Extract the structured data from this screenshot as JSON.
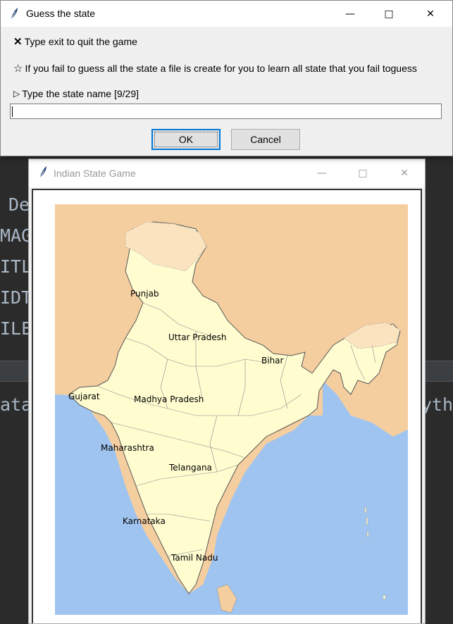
{
  "dialog": {
    "title": "Guess the state",
    "line_exit": "Type exit to quit the game",
    "line_fail": "If you fail to guess all the state a file is create for you to learn all state that you fail toguess",
    "line_prompt": "Type the state name [9/29]",
    "input_value": "",
    "ok_label": "OK",
    "cancel_label": "Cancel"
  },
  "game_window": {
    "title": "Indian State Game"
  },
  "ide_background": {
    "lines": [
      "De",
      "MAG",
      "ITL",
      "IDT",
      "ILE"
    ],
    "lower_left": "ata",
    "lower_right": "yth"
  },
  "map_labels": [
    {
      "name": "Punjab"
    },
    {
      "name": "Uttar Pradesh"
    },
    {
      "name": "Bihar"
    },
    {
      "name": "Gujarat"
    },
    {
      "name": "Madhya Pradesh"
    },
    {
      "name": "Maharashtra"
    },
    {
      "name": "Telangana"
    },
    {
      "name": "Karnataka"
    },
    {
      "name": "Tamil Nadu"
    }
  ],
  "colors": {
    "land_india": "#fffdd0",
    "land_neighbors": "#f5cea0",
    "sea": "#a0c4f0",
    "accent_default_button": "#0078d7"
  }
}
